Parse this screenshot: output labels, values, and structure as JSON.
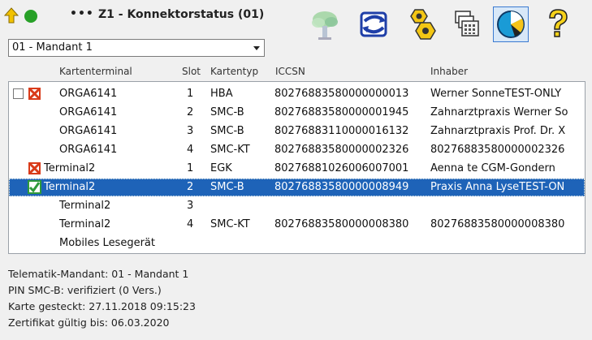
{
  "header": {
    "menu_dots": "•••",
    "title": "Z1 - Konnektorstatus (01)",
    "nav_color": "#f2c200",
    "status_color": "#27a027"
  },
  "mandant_select": {
    "value": "01 - Mandant 1"
  },
  "toolbar": {
    "icons": [
      "tree-icon",
      "sync-icon",
      "settings-nuts-icon",
      "card-terminals-icon",
      "status-pie-icon",
      "help-icon"
    ],
    "active": "status-pie-icon"
  },
  "columns": {
    "kartenterminal": "Kartenterminal",
    "slot": "Slot",
    "kartentyp": "Kartentyp",
    "iccsn": "ICCSN",
    "inhaber": "Inhaber"
  },
  "rows": [
    {
      "terminal": "ORGA6141",
      "slot": "1",
      "typ": "HBA",
      "iccsn": "80276883580000000013",
      "inhaber": "Werner SonneTEST-ONLY",
      "icon": "terminal-error-icon",
      "checkbox": true
    },
    {
      "terminal": "ORGA6141",
      "slot": "2",
      "typ": "SMC-B",
      "iccsn": "80276883580000001945",
      "inhaber": "Zahnarztpraxis Werner So"
    },
    {
      "terminal": "ORGA6141",
      "slot": "3",
      "typ": "SMC-B",
      "iccsn": "80276883110000016132",
      "inhaber": "Zahnarztpraxis Prof. Dr. X"
    },
    {
      "terminal": "ORGA6141",
      "slot": "4",
      "typ": "SMC-KT",
      "iccsn": "80276883580000002326",
      "inhaber": "80276883580000002326"
    },
    {
      "terminal": "Terminal2",
      "slot": "1",
      "typ": "EGK",
      "iccsn": "80276881026006007001",
      "inhaber": "Aenna te CGM-Gondern",
      "icon": "terminal-error-icon"
    },
    {
      "terminal": "Terminal2",
      "slot": "2",
      "typ": "SMC-B",
      "iccsn": "80276883580000008949",
      "inhaber": "Praxis Anna LyseTEST-ON",
      "icon": "terminal-ok-icon",
      "selected": true
    },
    {
      "terminal": "Terminal2",
      "slot": "3",
      "typ": "",
      "iccsn": "",
      "inhaber": ""
    },
    {
      "terminal": "Terminal2",
      "slot": "4",
      "typ": "SMC-KT",
      "iccsn": "80276883580000008380",
      "inhaber": "80276883580000008380"
    },
    {
      "terminal": "Mobiles Lesegerät",
      "slot": "",
      "typ": "",
      "iccsn": "",
      "inhaber": ""
    }
  ],
  "details": {
    "line1": "Telematik-Mandant: 01 - Mandant 1",
    "line2": "PIN SMC-B: verifiziert (0 Vers.)",
    "line3": "Karte gesteckt: 27.11.2018 09:15:23",
    "line4": "Zertifikat gültig bis: 06.03.2020"
  },
  "colors": {
    "selection": "#1e63b8",
    "error_icon": "#d93b1a",
    "ok_icon": "#2f9a3a"
  }
}
